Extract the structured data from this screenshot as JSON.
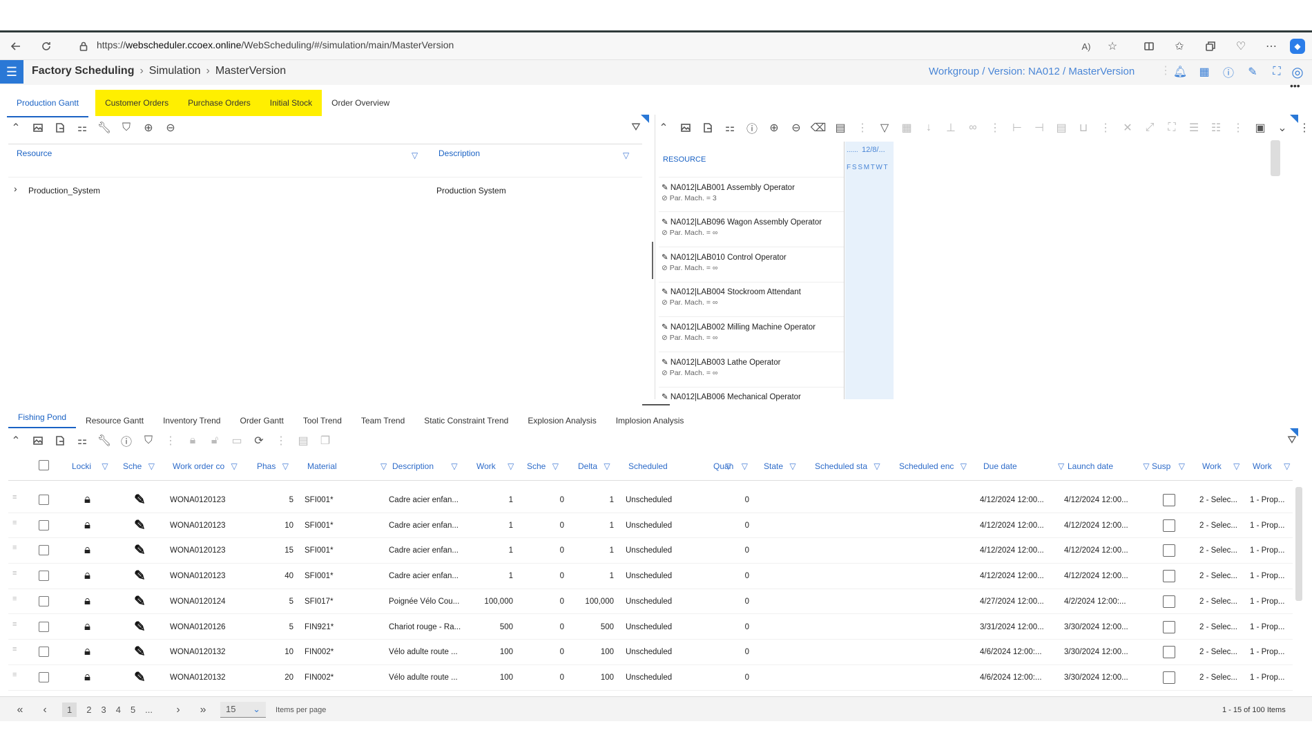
{
  "browser": {
    "url_prefix": "https://",
    "url_host": "webscheduler.ccoex.online",
    "url_path": "/WebScheduling/#/simulation/main/MasterVersion"
  },
  "app": {
    "title": "Factory Scheduling",
    "crumb_1": "Simulation",
    "crumb_2": "MasterVersion",
    "workgroup": "Workgroup / Version: NA012 / MasterVersion"
  },
  "top_tabs": [
    {
      "label": "Production Gantt",
      "active": true,
      "highlight": false
    },
    {
      "label": "Customer Orders",
      "active": false,
      "highlight": true
    },
    {
      "label": "Purchase Orders",
      "active": false,
      "highlight": true
    },
    {
      "label": "Initial Stock",
      "active": false,
      "highlight": true
    },
    {
      "label": "Order Overview",
      "active": false,
      "highlight": false
    }
  ],
  "tree": {
    "col_resource": "Resource",
    "col_description": "Description",
    "row_name": "Production_System",
    "row_desc": "Production System"
  },
  "gantt": {
    "resource_header": "RESOURCE",
    "date_label": "12/8/...",
    "dots_label": "......",
    "days": "F S S M T W T",
    "resources": [
      {
        "name": "NA012|LAB001 Assembly Operator",
        "sub": "Par. Mach. = 3"
      },
      {
        "name": "NA012|LAB096 Wagon Assembly Operator",
        "sub": "Par. Mach. = ∞"
      },
      {
        "name": "NA012|LAB010 Control Operator",
        "sub": "Par. Mach. = ∞"
      },
      {
        "name": "NA012|LAB004 Stockroom Attendant",
        "sub": "Par. Mach. = ∞"
      },
      {
        "name": "NA012|LAB002 Milling Machine Operator",
        "sub": "Par. Mach. = ∞"
      },
      {
        "name": "NA012|LAB003 Lathe Operator",
        "sub": "Par. Mach. = ∞"
      },
      {
        "name": "NA012|LAB006 Mechanical Operator",
        "sub": ""
      }
    ]
  },
  "bottom_tabs": [
    {
      "label": "Fishing Pond",
      "active": true
    },
    {
      "label": "Resource Gantt",
      "active": false
    },
    {
      "label": "Inventory Trend",
      "active": false
    },
    {
      "label": "Order Gantt",
      "active": false
    },
    {
      "label": "Tool Trend",
      "active": false
    },
    {
      "label": "Team Trend",
      "active": false
    },
    {
      "label": "Static Constraint Trend",
      "active": false
    },
    {
      "label": "Explosion Analysis",
      "active": false
    },
    {
      "label": "Implosion Analysis",
      "active": false
    }
  ],
  "grid": {
    "headers": {
      "lock": "Locki",
      "sched": "Sche",
      "work_order": "Work order co",
      "phase": "Phas",
      "material": "Material",
      "description": "Description",
      "work": "Work",
      "sche2": "Sche",
      "delta": "Delta",
      "scheduled": "Scheduled",
      "quan": "Quan",
      "state": "State",
      "sched_start": "Scheduled sta",
      "sched_end": "Scheduled enc",
      "due_date": "Due date",
      "launch_date": "Launch date",
      "susp": "Susp",
      "work2": "Work",
      "work3": "Work"
    },
    "rows": [
      {
        "wo": "WONA0120123",
        "phase": "5",
        "material": "SFI001*",
        "desc": "Cadre acier enfan...",
        "work": "1",
        "sche": "0",
        "delta": "1",
        "scheduled": "Unscheduled",
        "quan": "0",
        "due": "4/12/2024 12:00...",
        "launch": "4/12/2024 12:00...",
        "w2": "2 - Selec...",
        "w3": "1 - Prop..."
      },
      {
        "wo": "WONA0120123",
        "phase": "10",
        "material": "SFI001*",
        "desc": "Cadre acier enfan...",
        "work": "1",
        "sche": "0",
        "delta": "1",
        "scheduled": "Unscheduled",
        "quan": "0",
        "due": "4/12/2024 12:00...",
        "launch": "4/12/2024 12:00...",
        "w2": "2 - Selec...",
        "w3": "1 - Prop..."
      },
      {
        "wo": "WONA0120123",
        "phase": "15",
        "material": "SFI001*",
        "desc": "Cadre acier enfan...",
        "work": "1",
        "sche": "0",
        "delta": "1",
        "scheduled": "Unscheduled",
        "quan": "0",
        "due": "4/12/2024 12:00...",
        "launch": "4/12/2024 12:00...",
        "w2": "2 - Selec...",
        "w3": "1 - Prop..."
      },
      {
        "wo": "WONA0120123",
        "phase": "40",
        "material": "SFI001*",
        "desc": "Cadre acier enfan...",
        "work": "1",
        "sche": "0",
        "delta": "1",
        "scheduled": "Unscheduled",
        "quan": "0",
        "due": "4/12/2024 12:00...",
        "launch": "4/12/2024 12:00...",
        "w2": "2 - Selec...",
        "w3": "1 - Prop..."
      },
      {
        "wo": "WONA0120124",
        "phase": "5",
        "material": "SFI017*",
        "desc": "Poignée Vélo Cou...",
        "work": "100,000",
        "sche": "0",
        "delta": "100,000",
        "scheduled": "Unscheduled",
        "quan": "0",
        "due": "4/27/2024 12:00...",
        "launch": "4/2/2024 12:00:...",
        "w2": "2 - Selec...",
        "w3": "1 - Prop..."
      },
      {
        "wo": "WONA0120126",
        "phase": "5",
        "material": "FIN921*",
        "desc": "Chariot rouge - Ra...",
        "work": "500",
        "sche": "0",
        "delta": "500",
        "scheduled": "Unscheduled",
        "quan": "0",
        "due": "3/31/2024 12:00...",
        "launch": "3/30/2024 12:00...",
        "w2": "2 - Selec...",
        "w3": "1 - Prop..."
      },
      {
        "wo": "WONA0120132",
        "phase": "10",
        "material": "FIN002*",
        "desc": "Vélo adulte route ...",
        "work": "100",
        "sche": "0",
        "delta": "100",
        "scheduled": "Unscheduled",
        "quan": "0",
        "due": "4/6/2024 12:00:...",
        "launch": "3/30/2024 12:00...",
        "w2": "2 - Selec...",
        "w3": "1 - Prop..."
      },
      {
        "wo": "WONA0120132",
        "phase": "20",
        "material": "FIN002*",
        "desc": "Vélo adulte route ...",
        "work": "100",
        "sche": "0",
        "delta": "100",
        "scheduled": "Unscheduled",
        "quan": "0",
        "due": "4/6/2024 12:00:...",
        "launch": "3/30/2024 12:00...",
        "w2": "2 - Selec...",
        "w3": "1 - Prop..."
      }
    ]
  },
  "pager": {
    "pages": [
      "1",
      "2",
      "3",
      "4",
      "5",
      "..."
    ],
    "per_page": "15",
    "per_page_label": "Items per page",
    "summary": "1 - 15 of 100 Items"
  },
  "colors": {
    "accent": "#1a62c4",
    "highlight": "#ffef00"
  }
}
